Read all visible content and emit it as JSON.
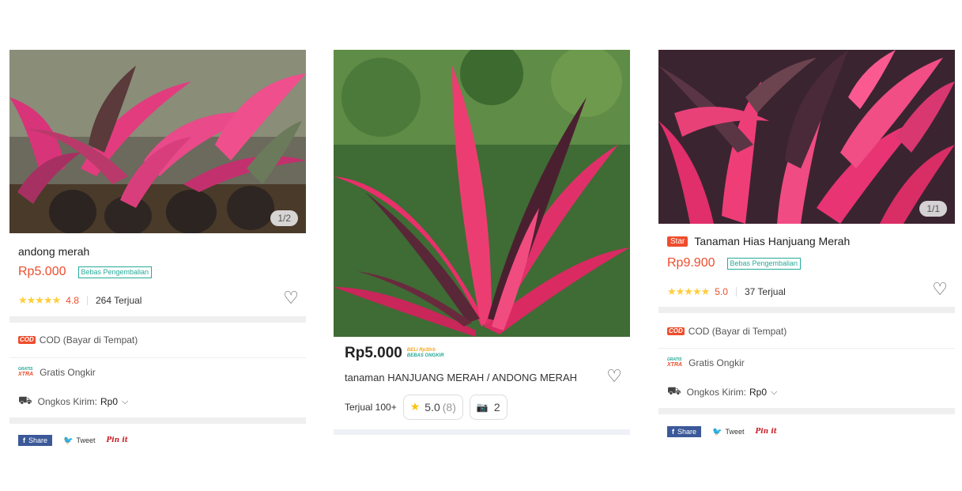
{
  "card_left": {
    "image_counter": "1/2",
    "title": "andong merah",
    "price": "Rp5.000",
    "return_badge": "Bebas Pengembalian",
    "stars": "★★★★★",
    "rating": "4.8",
    "sold": "264 Terjual",
    "heart": "♡",
    "cod_badge": "COD",
    "cod_label": "COD (Bayar di Tempat)",
    "gratis_top": "GRATIS",
    "gratis_bottom": "XTRA",
    "free_shipping": "Gratis Ongkir",
    "shipping_label": "Ongkos Kirim:",
    "shipping_value": "Rp0",
    "share": {
      "facebook_icon": "f",
      "facebook": "Share",
      "twitter_icon": "🐦",
      "twitter": "Tweet",
      "pinterest": "Pin it"
    }
  },
  "card_middle": {
    "price": "Rp5.000",
    "promo_top": "BELI Rp30rb",
    "promo_bottom": "BEBAS ONGKIR",
    "title": "tanaman HANJUANG MERAH / ANDONG MERAH",
    "heart": "♡",
    "sold": "Terjual 100+",
    "star": "★",
    "rating": "5.0",
    "reviews": "(8)",
    "camera_icon": "📷",
    "photos": "2"
  },
  "card_right": {
    "image_counter": "1/1",
    "star_badge": "Star",
    "title": "Tanaman Hias Hanjuang Merah",
    "price": "Rp9.900",
    "return_badge": "Bebas Pengembalian",
    "stars": "★★★★★",
    "rating": "5.0",
    "sold": "37 Terjual",
    "heart": "♡",
    "cod_badge": "COD",
    "cod_label": "COD (Bayar di Tempat)",
    "gratis_top": "GRATIS",
    "gratis_bottom": "XTRA",
    "free_shipping": "Gratis Ongkir",
    "shipping_label": "Ongkos Kirim:",
    "shipping_value": "Rp0",
    "share": {
      "facebook_icon": "f",
      "facebook": "Share",
      "twitter_icon": "🐦",
      "twitter": "Tweet",
      "pinterest": "Pin it"
    }
  },
  "icons": {
    "truck": "⛟",
    "chevron": "⌵"
  },
  "colors": {
    "accent": "#ee4d2d",
    "teal": "#26aa99",
    "star": "#ffce3d",
    "leaf_pink": "#e8306a",
    "leaf_dark": "#4a2030"
  }
}
